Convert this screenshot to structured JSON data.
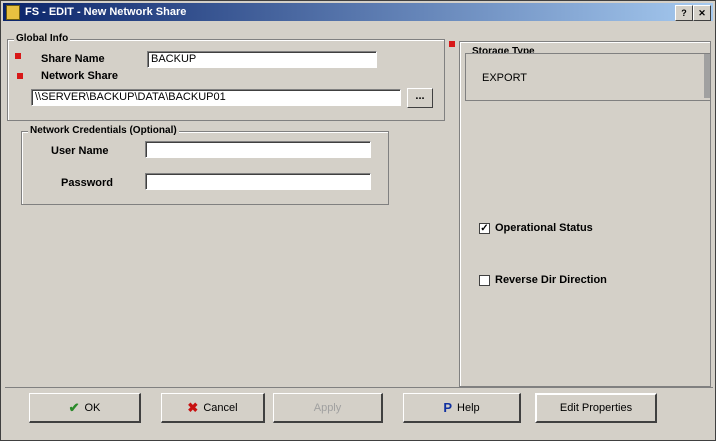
{
  "window": {
    "title": "FS - EDIT - New Network Share"
  },
  "section": {
    "title": "Global Info",
    "share_name_label": "Share Name",
    "share_name_value": "BACKUP",
    "network_share_label": "Network Share",
    "network_share_value": "\\\\SERVER\\BACKUP\\DATA\\BACKUP01"
  },
  "credentials": {
    "title": "Network Credentials (Optional)",
    "username_label": "User Name",
    "username_value": "",
    "password_label": "Password",
    "password_value": ""
  },
  "storage": {
    "title": "Storage Type",
    "selected": "EXPORT",
    "operational_status_label": "Operational Status",
    "operational_status_checked": true,
    "reversed_direction_label": "Reverse Dir Direction",
    "reversed_direction_checked": false
  },
  "buttons": {
    "ok": "OK",
    "cancel": "Cancel",
    "apply": "Apply",
    "help": "Help",
    "properties": "Edit Properties"
  },
  "colors": {
    "accent": "#0a246a",
    "required": "#d81818",
    "face": "#d4d0c8"
  },
  "icons": {
    "ok": "check-icon",
    "cancel": "cancel-icon",
    "help": "help-icon"
  }
}
